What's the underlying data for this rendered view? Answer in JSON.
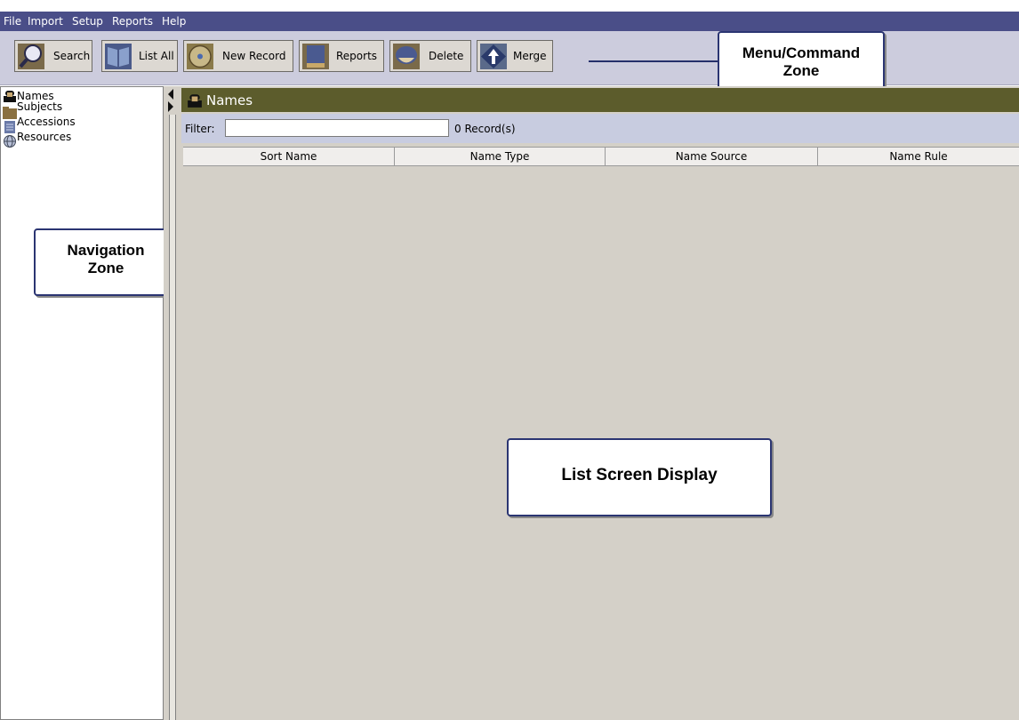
{
  "menu": [
    "File",
    "Import",
    "Setup",
    "Reports",
    "Help"
  ],
  "toolbar": {
    "search": "Search",
    "list_all": "List All",
    "new_record": "New Record",
    "reports": "Reports",
    "delete": "Delete",
    "merge": "Merge"
  },
  "callouts": {
    "menu_line1": "Menu/Command",
    "menu_line2": "Zone",
    "nav_line1": "Navigation",
    "nav_line2": "Zone",
    "list": "List Screen Display"
  },
  "nav": {
    "items": [
      {
        "label": "Names",
        "icon": "person-icon"
      },
      {
        "label": "Subjects",
        "icon": "folder-icon"
      },
      {
        "label": "Accessions",
        "icon": "document-icon"
      },
      {
        "label": "Resources",
        "icon": "globe-icon"
      }
    ]
  },
  "main": {
    "title": "Names",
    "filter_label": "Filter:",
    "filter_value": "",
    "record_count": "0 Record(s)",
    "columns": [
      "Sort Name",
      "Name Type",
      "Name Source",
      "Name Rule"
    ]
  },
  "colors": {
    "menubar": "#4a4e88",
    "toolbar": "#ccccdd",
    "titlebar": "#5c5c2c",
    "filterbar": "#c8cce0",
    "content": "#d4d0c8",
    "callout_border": "#2b3572"
  }
}
